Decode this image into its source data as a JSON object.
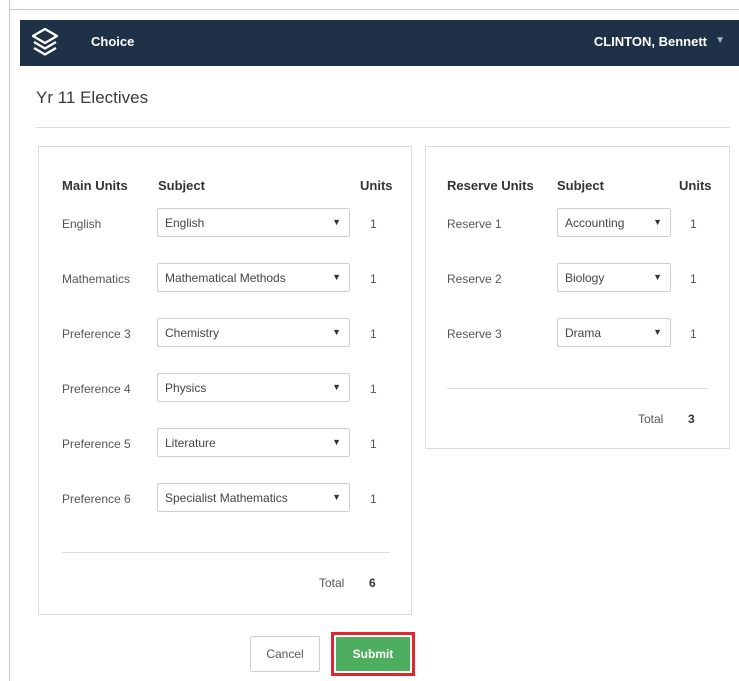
{
  "app": {
    "name": "Choice",
    "user": "CLINTON, Bennett"
  },
  "page": {
    "title": "Yr 11 Electives"
  },
  "main": {
    "headers": {
      "units_label": "Main Units",
      "subject": "Subject",
      "units": "Units"
    },
    "rows": [
      {
        "label": "English",
        "subject": "English",
        "units": "1"
      },
      {
        "label": "Mathematics",
        "subject": "Mathematical Methods",
        "units": "1"
      },
      {
        "label": "Preference 3",
        "subject": "Chemistry",
        "units": "1"
      },
      {
        "label": "Preference 4",
        "subject": "Physics",
        "units": "1"
      },
      {
        "label": "Preference 5",
        "subject": "Literature",
        "units": "1"
      },
      {
        "label": "Preference 6",
        "subject": "Specialist Mathematics",
        "units": "1"
      }
    ],
    "total_label": "Total",
    "total_value": "6"
  },
  "reserve": {
    "headers": {
      "units_label": "Reserve Units",
      "subject": "Subject",
      "units": "Units"
    },
    "rows": [
      {
        "label": "Reserve 1",
        "subject": "Accounting",
        "units": "1"
      },
      {
        "label": "Reserve 2",
        "subject": "Biology",
        "units": "1"
      },
      {
        "label": "Reserve 3",
        "subject": "Drama",
        "units": "1"
      }
    ],
    "total_label": "Total",
    "total_value": "3"
  },
  "actions": {
    "cancel": "Cancel",
    "submit": "Submit"
  },
  "icons": {
    "logo": "layers-icon",
    "user_menu": "caret-down-icon",
    "select_arrow": "caret-down-icon"
  },
  "colors": {
    "navbar": "#1f3147",
    "submit": "#4cae5e",
    "highlight": "#e0262e"
  }
}
